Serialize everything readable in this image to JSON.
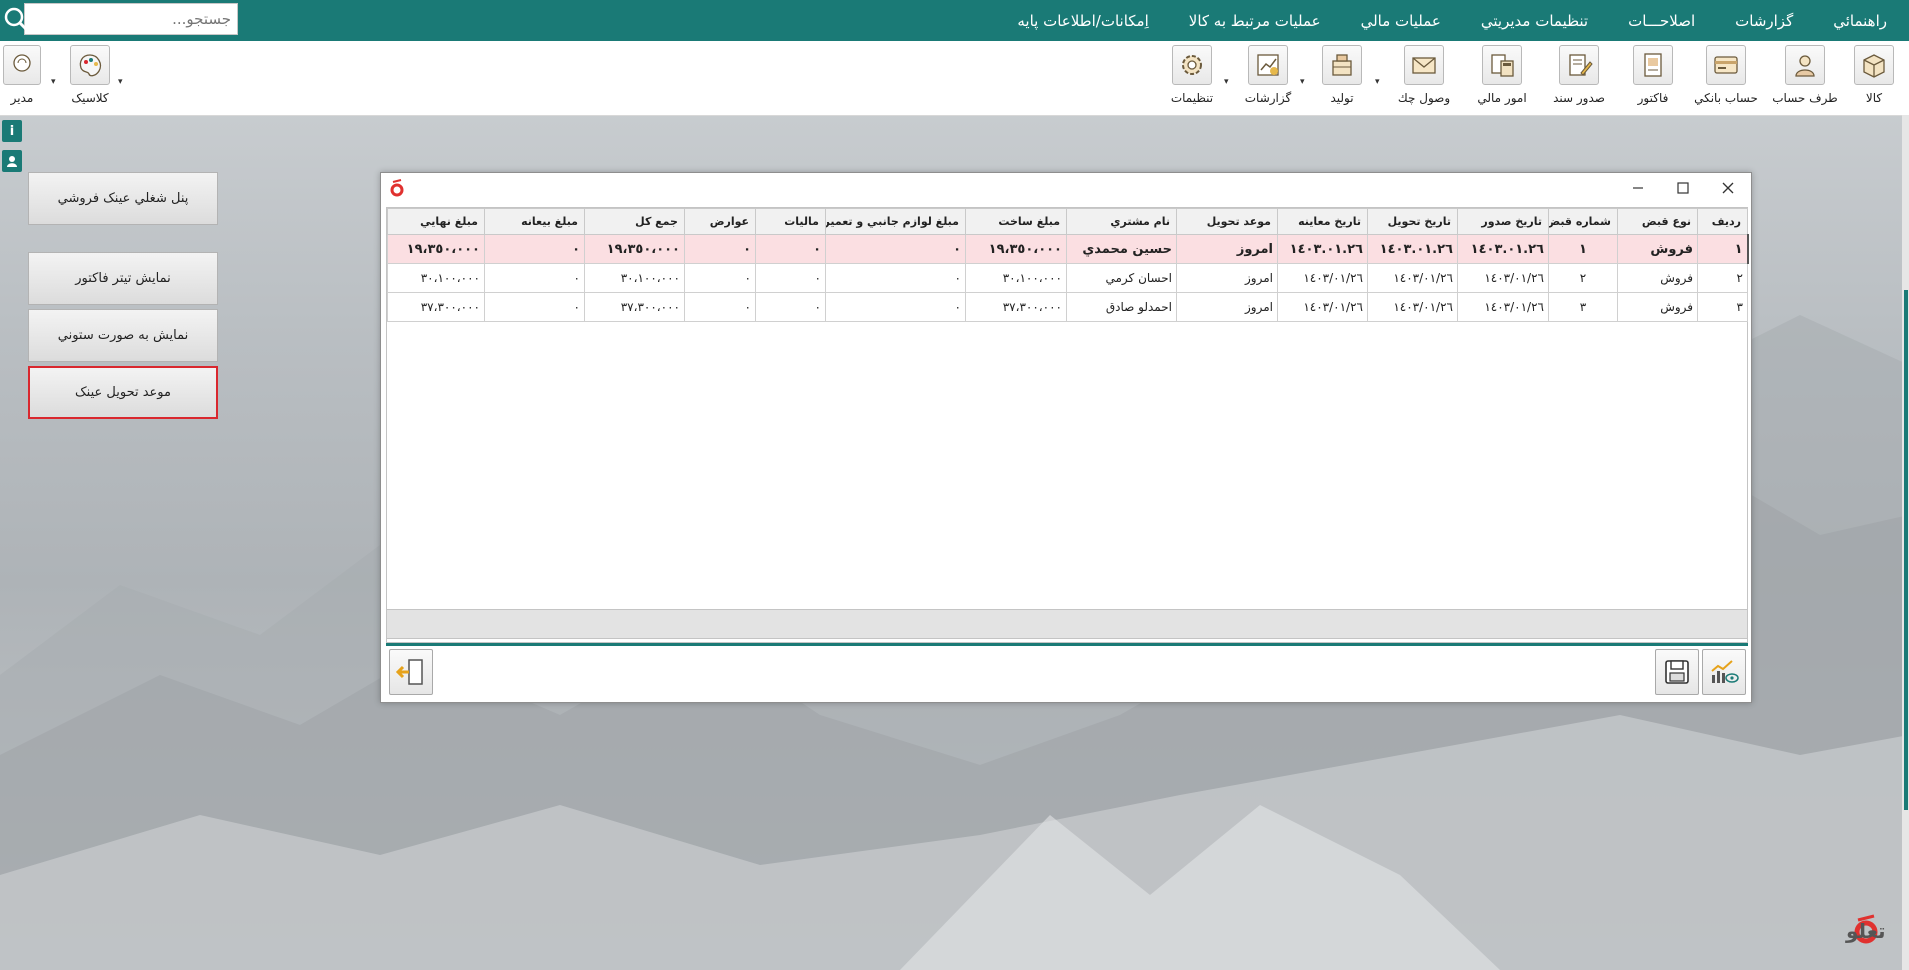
{
  "colors": {
    "accent": "#1a7a76",
    "selection": "#fbdfe2",
    "highlight_border": "#d9272e",
    "logo_red": "#e0312f"
  },
  "search": {
    "placeholder": "جستجو...",
    "icon": "search-icon"
  },
  "menu": {
    "items": [
      "اِمکانات/اطلاعات پايه",
      "عمليات مرتبط به کالا",
      "عمليات مالي",
      "تنظيمات مديريتي",
      "اصلاحـــات",
      "گزارشات",
      "راهنمائي"
    ]
  },
  "toolbar": {
    "buttons": [
      {
        "label": "کالا",
        "icon": "box-icon"
      },
      {
        "label": "طرف حساب",
        "icon": "person-icon"
      },
      {
        "label": "حساب بانکي",
        "icon": "bank-card-icon"
      },
      {
        "label": "فاکتور",
        "icon": "invoice-icon"
      },
      {
        "label": "صدور سند",
        "icon": "document-pen-icon"
      },
      {
        "label": "امور مالي",
        "icon": "finance-calculator-icon"
      },
      {
        "label": "وصول چك",
        "icon": "check-envelope-icon"
      },
      {
        "label": "توليد",
        "icon": "production-icon"
      },
      {
        "label": "گزارشات",
        "icon": "report-chart-icon"
      },
      {
        "label": "تنظيمات",
        "icon": "gear-icon"
      }
    ],
    "theme_label": "کلاسيک",
    "user_label": "مدير"
  },
  "side_panel": {
    "buttons": [
      "پنل شغلي عينک فروشي",
      "نمايش تيتر فاکتور",
      "نمايش به صورت ستوني",
      "موعد تحويل عينک"
    ]
  },
  "grid": {
    "columns": [
      "رديف",
      "نوع قبض",
      "شماره قبض",
      "تاريخ صدور",
      "تاريخ تحويل",
      "تاريخ معاينه",
      "موعد تحويل",
      "نام مشتري",
      "مبلغ ساخت",
      "مبلغ لوازم جانبي و تعميرات",
      "ماليات",
      "عوارض",
      "جمع کل",
      "مبلغ بيعانه",
      "مبلغ نهايي"
    ],
    "rows": [
      [
        "١",
        "فروش",
        "١",
        "١٤٠٣.٠١.٢٦",
        "١٤٠٣.٠١.٢٦",
        "١٤٠٣.٠١.٢٦",
        "امروز",
        "حسين محمدي",
        "١٩،٣٥٠،٠٠٠",
        "٠",
        "٠",
        "٠",
        "١٩،٣٥٠،٠٠٠",
        "٠",
        "١٩،٣٥٠،٠٠٠"
      ],
      [
        "٢",
        "فروش",
        "٢",
        "١٤٠٣/٠١/٢٦",
        "١٤٠٣/٠١/٢٦",
        "١٤٠٣/٠١/٢٦",
        "امروز",
        "احسان کرمي",
        "٣٠،١٠٠،٠٠٠",
        "٠",
        "٠",
        "٠",
        "٣٠،١٠٠،٠٠٠",
        "٠",
        "٣٠،١٠٠،٠٠٠"
      ],
      [
        "٣",
        "فروش",
        "٣",
        "١٤٠٣/٠١/٢٦",
        "١٤٠٣/٠١/٢٦",
        "١٤٠٣/٠١/٢٦",
        "امروز",
        "احمدلو صادق",
        "٣٧،٣٠٠،٠٠٠",
        "٠",
        "٠",
        "٠",
        "٣٧،٣٠٠،٠٠٠",
        "٠",
        "٣٧،٣٠٠،٠٠٠"
      ]
    ],
    "selected_row": 0
  },
  "brand": {
    "text": "تعلو"
  }
}
